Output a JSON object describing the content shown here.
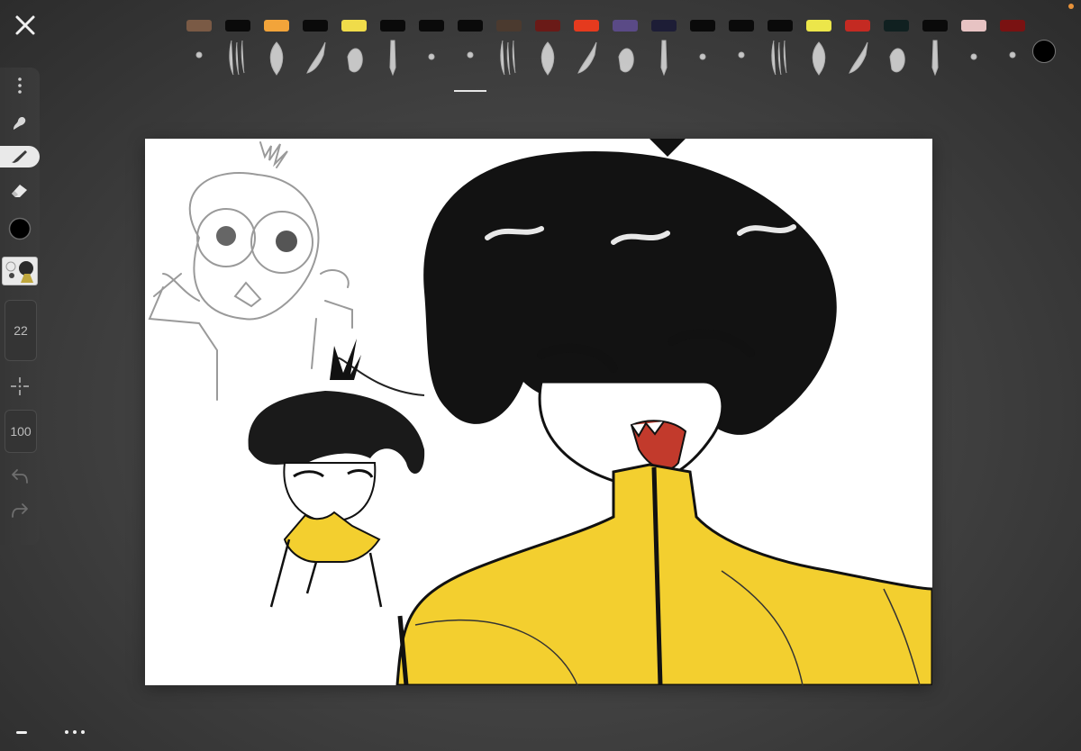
{
  "toolbar": {
    "brush_size": "22",
    "brush_opacity": "100",
    "current_color": "#000000"
  },
  "brushes": [
    {
      "color": "#7a5a45",
      "type": "soft"
    },
    {
      "color": "#0a0a0a",
      "type": "smudge"
    },
    {
      "color": "#f2a43a",
      "type": "airbrush"
    },
    {
      "color": "#0a0a0a",
      "type": "ink"
    },
    {
      "color": "#f0dc4a",
      "type": "watercolor"
    },
    {
      "color": "#0a0a0a",
      "type": "pencil"
    },
    {
      "color": "#0a0a0a",
      "type": "soft-dot"
    },
    {
      "color": "#0a0a0a",
      "type": "fineliner",
      "selected": true
    },
    {
      "color": "#4b3a2f",
      "type": "chalk"
    },
    {
      "color": "#6a1a17",
      "type": "ink-wash"
    },
    {
      "color": "#e53a1e",
      "type": "spray"
    },
    {
      "color": "#5a4a86",
      "type": "marker"
    },
    {
      "color": "#1d1d36",
      "type": "calligraphy"
    },
    {
      "color": "#0a0a0a",
      "type": "technical-pen"
    },
    {
      "color": "#0a0a0a",
      "type": "hatch"
    },
    {
      "color": "#0a0a0a",
      "type": "splatter"
    },
    {
      "color": "#ece64a",
      "type": "round-brush"
    },
    {
      "color": "#c42a22",
      "type": "dry-brush"
    },
    {
      "color": "#102020",
      "type": "flat-marker"
    },
    {
      "color": "#0a0a0a",
      "type": "blur"
    },
    {
      "color": "#e7c3c3",
      "type": "wash"
    },
    {
      "color": "#7a1212",
      "type": "eraser-brush"
    }
  ],
  "colors": {
    "accent_dot": "#e8923a",
    "ui_text": "#bdbdbd",
    "jacket_yellow": "#f3cf2f",
    "tongue_red": "#c23a2c"
  },
  "icons": [
    "close-icon",
    "more-vertical-icon",
    "smudge-icon",
    "brush-icon",
    "eraser-icon",
    "color-swatch-icon",
    "layers-thumbnail-icon",
    "transform-crosshair-icon",
    "undo-icon",
    "redo-icon",
    "more-horizontal-icon",
    "minimize-icon"
  ]
}
